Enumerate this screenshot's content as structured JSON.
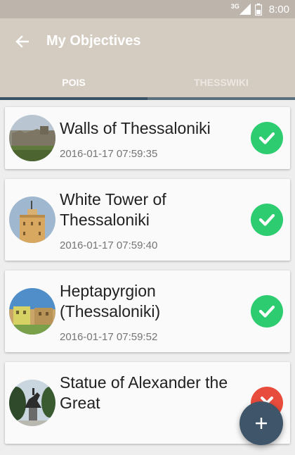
{
  "status_bar": {
    "network": "3G",
    "time": "8:00"
  },
  "app_bar": {
    "title": "My Objectives"
  },
  "tabs": [
    {
      "label": "POIS",
      "selected": true
    },
    {
      "label": "THESSWIKI",
      "selected": false
    }
  ],
  "objectives": [
    {
      "name": "Walls of Thessaloniki",
      "timestamp": "2016-01-17 07:59:35",
      "status": "completed",
      "status_icon": "check-icon"
    },
    {
      "name": "White Tower of Thessaloniki",
      "timestamp": "2016-01-17 07:59:40",
      "status": "completed",
      "status_icon": "check-icon"
    },
    {
      "name": "Heptapyrgion (Thessaloniki)",
      "timestamp": "2016-01-17 07:59:52",
      "status": "completed",
      "status_icon": "check-icon"
    },
    {
      "name": "Statue of Alexander the Great",
      "timestamp": "",
      "status": "not-completed",
      "status_icon": "cross-icon"
    }
  ],
  "fab": {
    "icon": "plus-icon"
  },
  "colors": {
    "app_bar": "#d4cbc1",
    "tab_indicator": "#3a5265",
    "completed": "#2ecc71",
    "not_completed": "#e74c3c",
    "fab": "#3f5569"
  }
}
